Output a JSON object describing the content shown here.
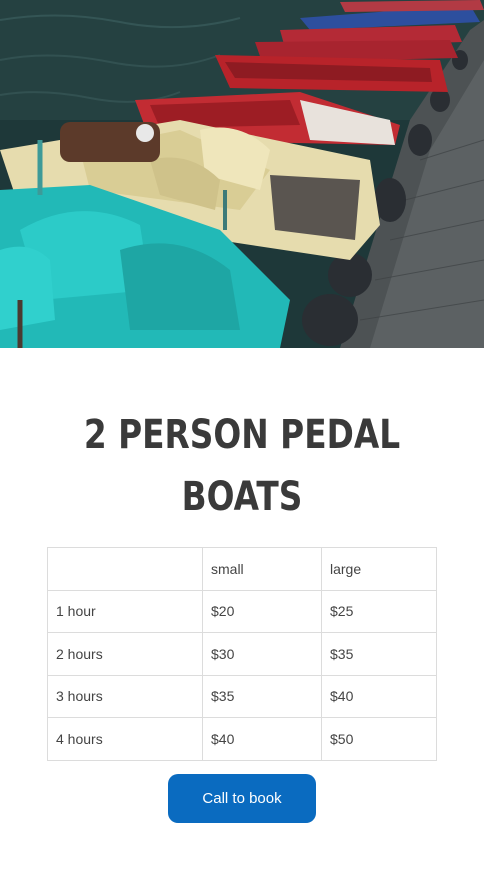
{
  "hero_image": {
    "name": "pedal-boats-photo",
    "colors": {
      "water": "#203b3c",
      "teal_boat": "#22b9b7",
      "cream_boat": "#e6dcae",
      "red_boat": "#b8232a",
      "blue_boat": "#2d4f9e",
      "dock": "#555a5c"
    }
  },
  "title_lines": [
    "2 PERSON PEDAL",
    "BOATS"
  ],
  "pricing_table": {
    "headers": [
      "",
      "small",
      "large"
    ],
    "rows": [
      [
        "1 hour",
        "$20",
        "$25"
      ],
      [
        "2 hours",
        "$30",
        "$35"
      ],
      [
        "3 hours",
        "$35",
        "$40"
      ],
      [
        "4 hours",
        "$40",
        "$50"
      ]
    ]
  },
  "cta": {
    "label": "Call to book",
    "color": "#0a6bc0"
  }
}
